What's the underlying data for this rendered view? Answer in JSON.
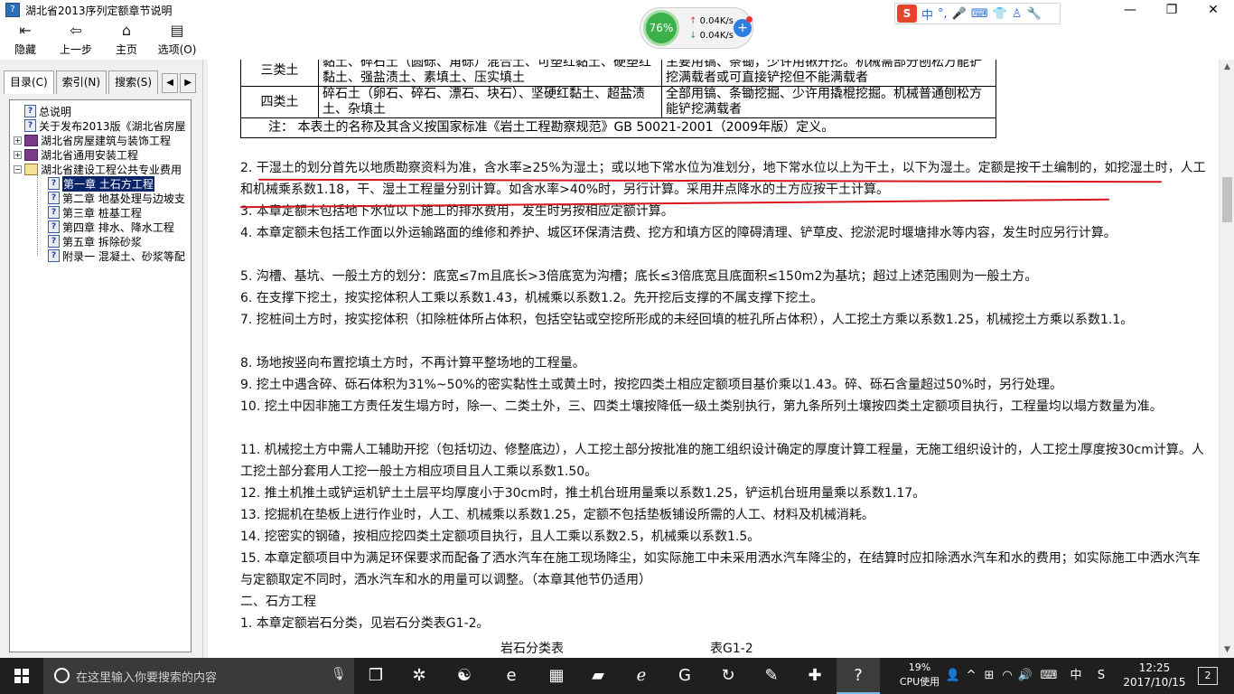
{
  "window": {
    "title": "湖北省2013序列定额章节说明",
    "controls": [
      "—",
      "❐",
      "✕"
    ]
  },
  "toolbar": [
    {
      "label": "隐藏",
      "icon": "hide-icon",
      "glyph": "⇤"
    },
    {
      "label": "上一步",
      "icon": "back-icon",
      "glyph": "⇦"
    },
    {
      "label": "主页",
      "icon": "home-icon",
      "glyph": "⌂"
    },
    {
      "label": "选项(O)",
      "icon": "options-icon",
      "glyph": "▤"
    }
  ],
  "netwidget": {
    "percent": "76%",
    "upload": "0.04K/s",
    "download": "0.04K/s"
  },
  "ime": {
    "items": [
      "中",
      "°,",
      "🎤",
      "⌨",
      "👕",
      "♙",
      "🔧"
    ]
  },
  "sidebar": {
    "tabs": [
      "目录(C)",
      "索引(N)",
      "搜索(S)"
    ],
    "tree": [
      {
        "label": "总说明",
        "type": "doc",
        "indent": 0
      },
      {
        "label": "关于发布2013版《湖北省房屋",
        "type": "doc",
        "indent": 0
      },
      {
        "label": "湖北省房屋建筑与装饰工程",
        "type": "book",
        "indent": 0,
        "expander": "+"
      },
      {
        "label": "湖北省通用安装工程",
        "type": "book",
        "indent": 0,
        "expander": "+"
      },
      {
        "label": "湖北省建设工程公共专业费用",
        "type": "book-open",
        "indent": 0,
        "expander": "−"
      },
      {
        "label": "第一章  土石方工程",
        "type": "doc",
        "indent": 1,
        "selected": true
      },
      {
        "label": "第二章  地基处理与边坡支",
        "type": "doc",
        "indent": 1
      },
      {
        "label": "第三章  桩基工程",
        "type": "doc",
        "indent": 1
      },
      {
        "label": "第四章  排水、降水工程",
        "type": "doc",
        "indent": 1
      },
      {
        "label": "第五章  拆除砂浆",
        "type": "doc",
        "indent": 1
      },
      {
        "label": "附录一  混凝土、砂浆等配",
        "type": "doc",
        "indent": 1
      }
    ]
  },
  "content": {
    "table_rows": [
      {
        "cls": "三类土",
        "soil": "黏土、碎石土（圆砾、角砾）混合土、可塑红黏土、硬塑红黏土、强盐渍土、素填土、压实填土",
        "method": "主要用镐、条锄，少许用锹开挖。机械需部分刨松方能铲挖满载者或可直接铲挖但不能满载者"
      },
      {
        "cls": "四类土",
        "soil": "碎石土（卵石、碎石、漂石、块石）、坚硬红黏土、超盐渍土、杂填土",
        "method": "全部用镐、条锄挖掘、少许用撬棍挖掘。机械普通刨松方能铲挖满载者"
      }
    ],
    "table_note": "注：  本表土的名称及其含义按国家标准《岩土工程勘察规范》GB 50021-2001（2009年版）定义。",
    "paragraphs": [
      "2. 干湿土的划分首先以地质勘察资料为准，含水率≥25%为湿土；或以地下常水位为准划分，地下常水位以上为干土，以下为湿土。定额是按干土编制的，如挖湿土时，人工和机械乘系数1.18，干、湿土工程量分别计算。如含水率>40%时，另行计算。采用井点降水的土方应按干土计算。",
      "3. 本章定额未包括地下水位以下施工的排水费用，发生时另按相应定额计算。",
      "4. 本章定额未包括工作面以外运输路面的维修和养护、城区环保清洁费、挖方和填方区的障碍清理、铲草皮、挖淤泥时堰塘排水等内容，发生时应另行计算。",
      "5. 沟槽、基坑、一般土方的划分：底宽≤7m且底长>3倍底宽为沟槽；底长≤3倍底宽且底面积≤150m2为基坑；超过上述范围则为一般土方。",
      "6. 在支撑下挖土，按实挖体积人工乘以系数1.43，机械乘以系数1.2。先开挖后支撑的不属支撑下挖土。",
      "7. 挖桩间土方时，按实挖体积（扣除桩体所占体积，包括空钻或空挖所形成的未经回填的桩孔所占体积），人工挖土方乘以系数1.25，机械挖土方乘以系数1.1。",
      "8. 场地按竖向布置挖填土方时，不再计算平整场地的工程量。",
      "9. 挖土中遇含碎、砾石体积为31%~50%的密实黏性土或黄土时，按挖四类土相应定额项目基价乘以1.43。碎、砾石含量超过50%时，另行处理。",
      "10. 挖土中因非施工方责任发生塌方时，除一、二类土外，三、四类土壤按降低一级土类别执行，第九条所列土壤按四类土定额项目执行，工程量均以塌方数量为准。",
      "11. 机械挖土方中需人工辅助开挖（包括切边、修整底边），人工挖土部分按批准的施工组织设计确定的厚度计算工程量，无施工组织设计的，人工挖土厚度按30cm计算。人工挖土部分套用人工挖一般土方相应项目且人工乘以系数1.50。",
      "12. 推土机推土或铲运机铲土土层平均厚度小于30cm时，推土机台班用量乘以系数1.25，铲运机台班用量乘以系数1.17。",
      "13. 挖掘机在垫板上进行作业时，人工、机械乘以系数1.25，定额不包括垫板铺设所需的人工、材料及机械消耗。",
      "14. 挖密实的钢碴，按相应挖四类土定额项目执行，且人工乘以系数2.5，机械乘以系数1.5。",
      "15. 本章定额项目中为满足环保要求而配备了洒水汽车在施工现场降尘，如实际施工中未采用洒水汽车降尘的，在结算时应扣除洒水汽车和水的费用；如实际施工中洒水汽车与定额取定不同时，洒水汽车和水的用量可以调整。（本章其他节仍适用）",
      "二、石方工程",
      "1. 本章定额岩石分类，见岩石分类表G1-2。"
    ],
    "caption_left": "岩石分类表",
    "caption_right": "表G1-2"
  },
  "taskbar": {
    "search_placeholder": "在这里输入你要搜索的内容",
    "apps": [
      {
        "name": "task-view-app",
        "glyph": "❐"
      },
      {
        "name": "fan-app",
        "glyph": "✲"
      },
      {
        "name": "cortana-swirl-app",
        "glyph": "☯"
      },
      {
        "name": "edge-app",
        "glyph": "e"
      },
      {
        "name": "store-app",
        "glyph": "▦"
      },
      {
        "name": "file-explorer-app",
        "glyph": "▰"
      },
      {
        "name": "ie-app",
        "glyph": "ℯ"
      },
      {
        "name": "chrome-app",
        "glyph": "G"
      },
      {
        "name": "refresh-app",
        "glyph": "↻"
      },
      {
        "name": "notes-app",
        "glyph": "✎"
      },
      {
        "name": "plus-app",
        "glyph": "✚"
      },
      {
        "name": "help-app",
        "glyph": "?"
      }
    ],
    "cpu_percent": "19%",
    "cpu_label": "CPU使用",
    "tray": [
      "👤",
      "^",
      "⊞",
      "◠",
      "🔊",
      "⌨",
      "中",
      "S"
    ],
    "time": "12:25",
    "date": "2017/10/15",
    "notifications": "2"
  },
  "colors": {
    "accent_red": "#d8141e",
    "selection": "#0a246a",
    "taskbar": "#1f1f1f"
  }
}
